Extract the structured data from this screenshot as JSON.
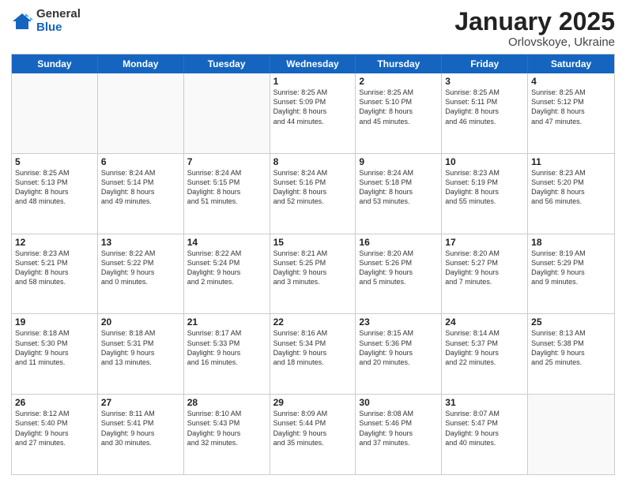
{
  "logo": {
    "general": "General",
    "blue": "Blue"
  },
  "title": "January 2025",
  "location": "Orlovskoye, Ukraine",
  "days_of_week": [
    "Sunday",
    "Monday",
    "Tuesday",
    "Wednesday",
    "Thursday",
    "Friday",
    "Saturday"
  ],
  "weeks": [
    [
      {
        "day": "",
        "info": ""
      },
      {
        "day": "",
        "info": ""
      },
      {
        "day": "",
        "info": ""
      },
      {
        "day": "1",
        "info": "Sunrise: 8:25 AM\nSunset: 5:09 PM\nDaylight: 8 hours\nand 44 minutes."
      },
      {
        "day": "2",
        "info": "Sunrise: 8:25 AM\nSunset: 5:10 PM\nDaylight: 8 hours\nand 45 minutes."
      },
      {
        "day": "3",
        "info": "Sunrise: 8:25 AM\nSunset: 5:11 PM\nDaylight: 8 hours\nand 46 minutes."
      },
      {
        "day": "4",
        "info": "Sunrise: 8:25 AM\nSunset: 5:12 PM\nDaylight: 8 hours\nand 47 minutes."
      }
    ],
    [
      {
        "day": "5",
        "info": "Sunrise: 8:25 AM\nSunset: 5:13 PM\nDaylight: 8 hours\nand 48 minutes."
      },
      {
        "day": "6",
        "info": "Sunrise: 8:24 AM\nSunset: 5:14 PM\nDaylight: 8 hours\nand 49 minutes."
      },
      {
        "day": "7",
        "info": "Sunrise: 8:24 AM\nSunset: 5:15 PM\nDaylight: 8 hours\nand 51 minutes."
      },
      {
        "day": "8",
        "info": "Sunrise: 8:24 AM\nSunset: 5:16 PM\nDaylight: 8 hours\nand 52 minutes."
      },
      {
        "day": "9",
        "info": "Sunrise: 8:24 AM\nSunset: 5:18 PM\nDaylight: 8 hours\nand 53 minutes."
      },
      {
        "day": "10",
        "info": "Sunrise: 8:23 AM\nSunset: 5:19 PM\nDaylight: 8 hours\nand 55 minutes."
      },
      {
        "day": "11",
        "info": "Sunrise: 8:23 AM\nSunset: 5:20 PM\nDaylight: 8 hours\nand 56 minutes."
      }
    ],
    [
      {
        "day": "12",
        "info": "Sunrise: 8:23 AM\nSunset: 5:21 PM\nDaylight: 8 hours\nand 58 minutes."
      },
      {
        "day": "13",
        "info": "Sunrise: 8:22 AM\nSunset: 5:22 PM\nDaylight: 9 hours\nand 0 minutes."
      },
      {
        "day": "14",
        "info": "Sunrise: 8:22 AM\nSunset: 5:24 PM\nDaylight: 9 hours\nand 2 minutes."
      },
      {
        "day": "15",
        "info": "Sunrise: 8:21 AM\nSunset: 5:25 PM\nDaylight: 9 hours\nand 3 minutes."
      },
      {
        "day": "16",
        "info": "Sunrise: 8:20 AM\nSunset: 5:26 PM\nDaylight: 9 hours\nand 5 minutes."
      },
      {
        "day": "17",
        "info": "Sunrise: 8:20 AM\nSunset: 5:27 PM\nDaylight: 9 hours\nand 7 minutes."
      },
      {
        "day": "18",
        "info": "Sunrise: 8:19 AM\nSunset: 5:29 PM\nDaylight: 9 hours\nand 9 minutes."
      }
    ],
    [
      {
        "day": "19",
        "info": "Sunrise: 8:18 AM\nSunset: 5:30 PM\nDaylight: 9 hours\nand 11 minutes."
      },
      {
        "day": "20",
        "info": "Sunrise: 8:18 AM\nSunset: 5:31 PM\nDaylight: 9 hours\nand 13 minutes."
      },
      {
        "day": "21",
        "info": "Sunrise: 8:17 AM\nSunset: 5:33 PM\nDaylight: 9 hours\nand 16 minutes."
      },
      {
        "day": "22",
        "info": "Sunrise: 8:16 AM\nSunset: 5:34 PM\nDaylight: 9 hours\nand 18 minutes."
      },
      {
        "day": "23",
        "info": "Sunrise: 8:15 AM\nSunset: 5:36 PM\nDaylight: 9 hours\nand 20 minutes."
      },
      {
        "day": "24",
        "info": "Sunrise: 8:14 AM\nSunset: 5:37 PM\nDaylight: 9 hours\nand 22 minutes."
      },
      {
        "day": "25",
        "info": "Sunrise: 8:13 AM\nSunset: 5:38 PM\nDaylight: 9 hours\nand 25 minutes."
      }
    ],
    [
      {
        "day": "26",
        "info": "Sunrise: 8:12 AM\nSunset: 5:40 PM\nDaylight: 9 hours\nand 27 minutes."
      },
      {
        "day": "27",
        "info": "Sunrise: 8:11 AM\nSunset: 5:41 PM\nDaylight: 9 hours\nand 30 minutes."
      },
      {
        "day": "28",
        "info": "Sunrise: 8:10 AM\nSunset: 5:43 PM\nDaylight: 9 hours\nand 32 minutes."
      },
      {
        "day": "29",
        "info": "Sunrise: 8:09 AM\nSunset: 5:44 PM\nDaylight: 9 hours\nand 35 minutes."
      },
      {
        "day": "30",
        "info": "Sunrise: 8:08 AM\nSunset: 5:46 PM\nDaylight: 9 hours\nand 37 minutes."
      },
      {
        "day": "31",
        "info": "Sunrise: 8:07 AM\nSunset: 5:47 PM\nDaylight: 9 hours\nand 40 minutes."
      },
      {
        "day": "",
        "info": ""
      }
    ]
  ]
}
